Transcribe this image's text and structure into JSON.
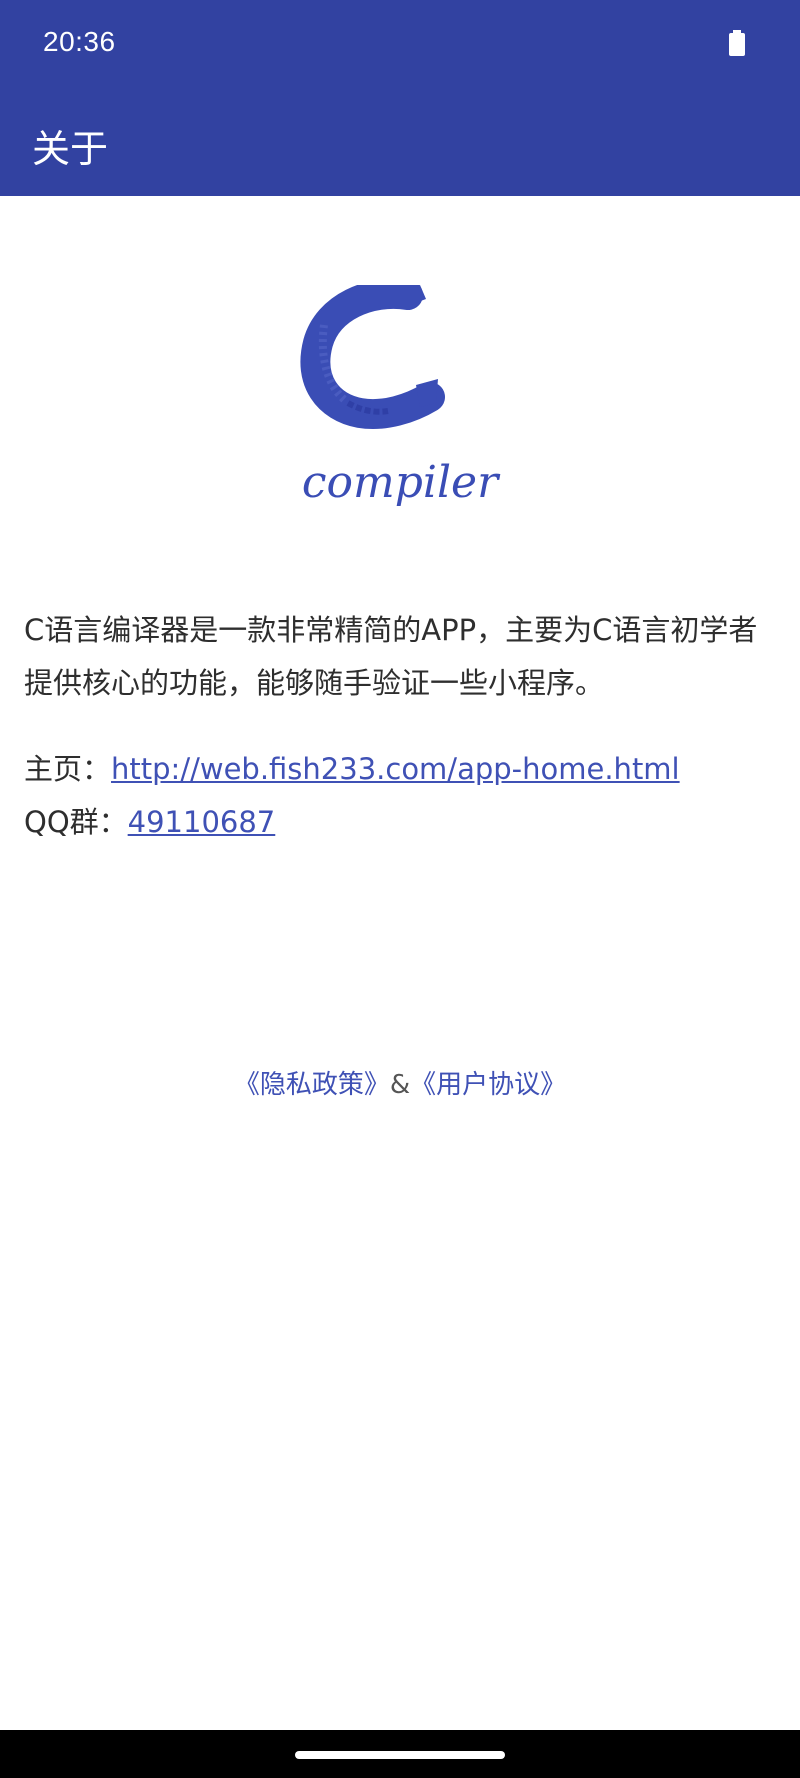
{
  "status_bar": {
    "time": "20:36",
    "battery_icon": "battery-full-icon"
  },
  "appbar": {
    "title": "关于"
  },
  "logo": {
    "letter": "C",
    "wordmark": "compiler",
    "color": "#3a4db5"
  },
  "description": "C语言编译器是一款非常精简的APP，主要为C语言初学者提供核心的功能，能够随手验证一些小程序。",
  "homepage": {
    "label": "主页：",
    "url": "http://web.fish233.com/app-home.html"
  },
  "qq_group": {
    "label": "QQ群：",
    "number": "49110687"
  },
  "policy": {
    "privacy": "《隐私政策》",
    "separator": "&",
    "agreement": "《用户协议》"
  },
  "colors": {
    "primary": "#3242a1",
    "link": "#3f51b5",
    "text": "#2e2e2e"
  }
}
